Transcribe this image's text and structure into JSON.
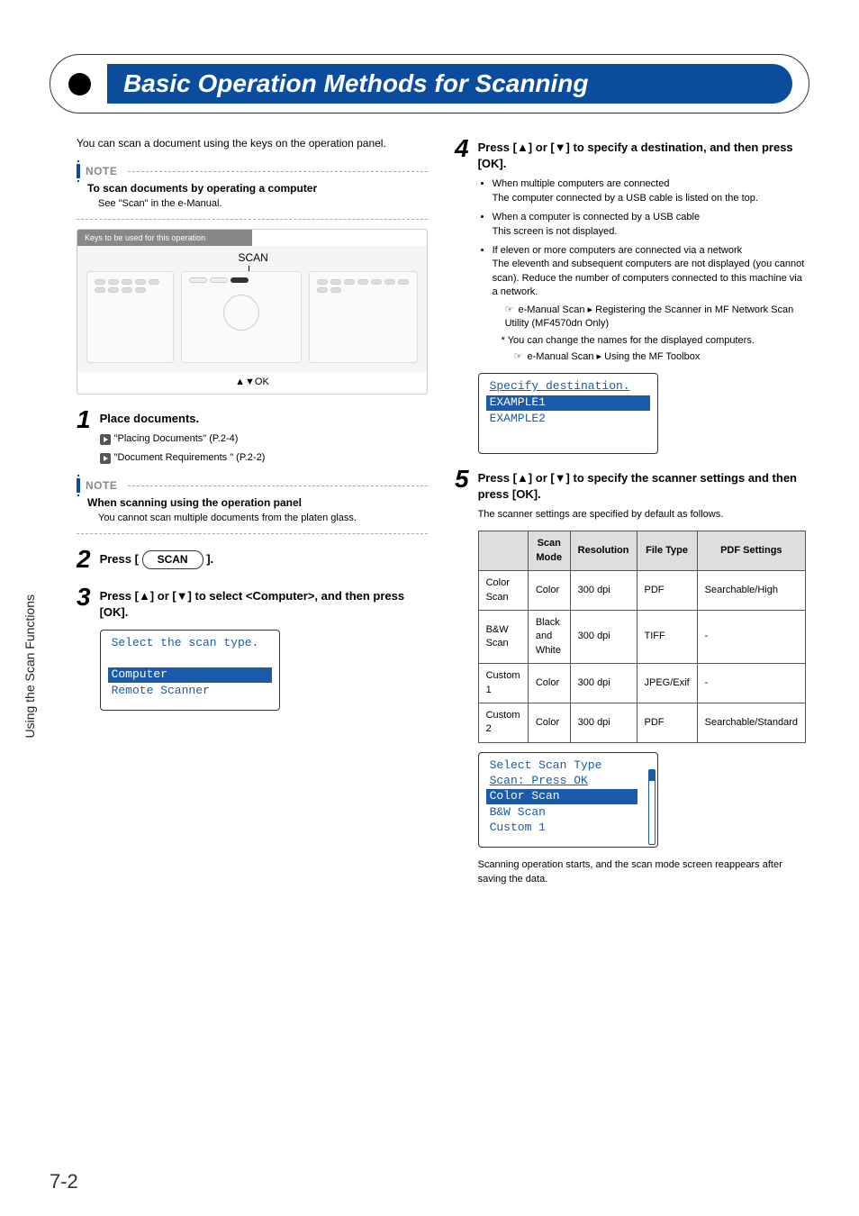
{
  "page": {
    "side_tab": "Using the Scan Functions",
    "number": "7-2"
  },
  "title": "Basic Operation Methods for Scanning",
  "intro": "You can scan a document using the keys on the operation panel.",
  "note1": {
    "label": "NOTE",
    "heading": "To scan documents by operating a computer",
    "body": "See \"Scan\" in the e-Manual."
  },
  "diagram": {
    "header": "Keys to be used for this operation",
    "scan_label": "SCAN",
    "ok_label": "▲▼OK"
  },
  "step1": {
    "num": "1",
    "title": "Place documents.",
    "ref1": "\"Placing Documents\" (P.2-4)",
    "ref2": "\"Document Requirements \" (P.2-2)"
  },
  "note2": {
    "label": "NOTE",
    "heading": "When scanning using the operation panel",
    "body": "You cannot scan multiple documents from the platen glass."
  },
  "step2": {
    "num": "2",
    "title_pre": "Press [ ",
    "scan_btn": "SCAN",
    "title_post": " ]."
  },
  "step3": {
    "num": "3",
    "title": "Press [▲] or [▼] to select <Computer>, and then press [OK].",
    "lcd": {
      "l1": "Select the scan type.",
      "sel": "Computer",
      "l3": "Remote Scanner"
    }
  },
  "step4": {
    "num": "4",
    "title": "Press [▲] or [▼] to specify a destination, and then press [OK].",
    "b1": "When multiple computers are connected",
    "b1d": "The computer connected by a USB cable is listed on the top.",
    "b2": "When a computer is connected by a USB cable",
    "b2d": "This screen is not displayed.",
    "b3": "If eleven or more computers are connected via a network",
    "b3d": "The eleventh and subsequent computers are not displayed (you cannot scan). Reduce the number of computers connected to this machine via a network.",
    "ref1": "e-Manual  Scan ▸ Registering the Scanner in MF Network Scan Utility (MF4570dn Only)",
    "star": "*  You can change the names for the displayed computers.",
    "ref2": "e-Manual  Scan ▸ Using the MF Toolbox",
    "lcd": {
      "l1": "Specify destination.",
      "sel": "EXAMPLE1",
      "l3": "EXAMPLE2"
    }
  },
  "step5": {
    "num": "5",
    "title": "Press [▲] or [▼] to specify the scanner settings and then press [OK].",
    "desc": "The scanner settings are specified by default as follows.",
    "table": {
      "headers": [
        "",
        "Scan Mode",
        "Resolution",
        "File Type",
        "PDF Settings"
      ],
      "rows": [
        [
          "Color Scan",
          "Color",
          "300 dpi",
          "PDF",
          "Searchable/High"
        ],
        [
          "B&W Scan",
          "Black and White",
          "300 dpi",
          "TIFF",
          "-"
        ],
        [
          "Custom 1",
          "Color",
          "300 dpi",
          "JPEG/Exif",
          "-"
        ],
        [
          "Custom 2",
          "Color",
          "300 dpi",
          "PDF",
          "Searchable/Standard"
        ]
      ]
    },
    "lcd": {
      "l1": "Select Scan Type",
      "l2": "Scan: Press OK",
      "sel": "Color Scan",
      "l4": "B&W Scan",
      "l5": "Custom 1"
    },
    "after": "Scanning operation starts, and the scan mode screen reappears after saving the data."
  }
}
